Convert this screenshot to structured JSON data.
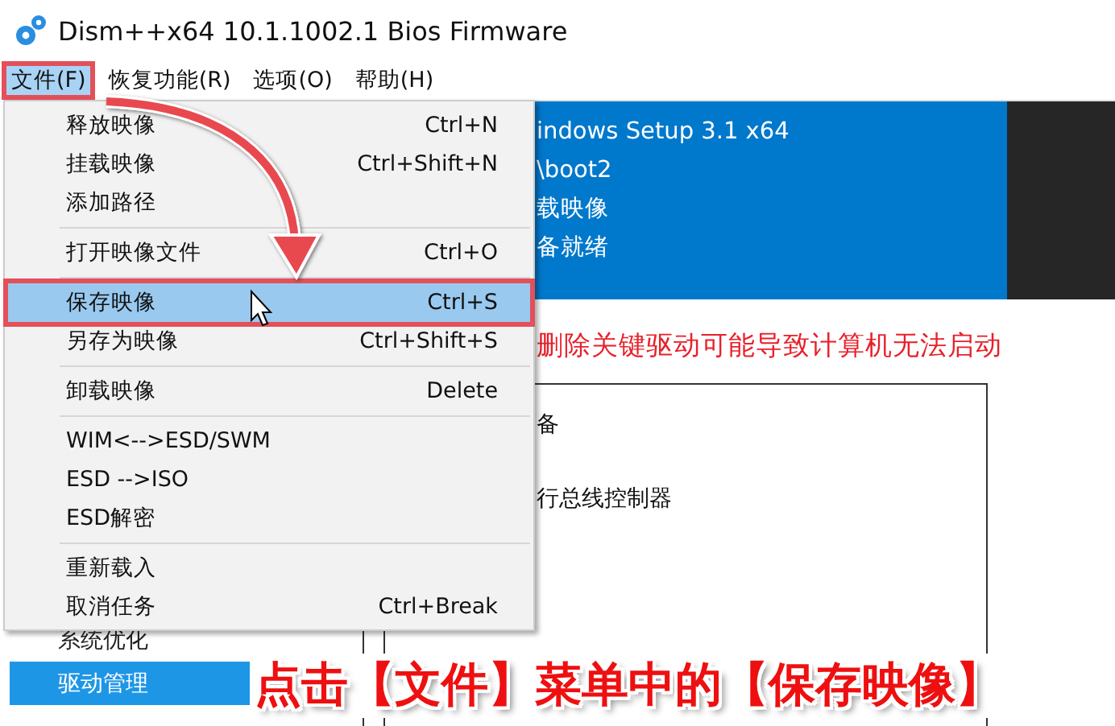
{
  "window": {
    "title": "Dism++x64 10.1.1002.1 Bios Firmware"
  },
  "menu_bar": [
    {
      "label": "文件(F)",
      "selected": true
    },
    {
      "label": "恢复功能(R)",
      "selected": false
    },
    {
      "label": "选项(O)",
      "selected": false
    },
    {
      "label": "帮助(H)",
      "selected": false
    }
  ],
  "file_menu": {
    "groups": [
      [
        {
          "label": "释放映像",
          "shortcut": "Ctrl+N",
          "selected": false
        },
        {
          "label": "挂载映像",
          "shortcut": "Ctrl+Shift+N",
          "selected": false
        },
        {
          "label": "添加路径",
          "selected": false
        }
      ],
      [
        {
          "label": "打开映像文件",
          "shortcut": "Ctrl+O",
          "selected": false
        }
      ],
      [
        {
          "label": "保存映像",
          "shortcut": "Ctrl+S",
          "selected": true
        },
        {
          "label": "另存为映像",
          "shortcut": "Ctrl+Shift+S",
          "selected": false
        }
      ],
      [
        {
          "label": "卸载映像",
          "shortcut": "Delete",
          "selected": false
        }
      ],
      [
        {
          "label": "WIM<-->ESD/SWM",
          "selected": false
        },
        {
          "label": "ESD -->ISO",
          "selected": false
        },
        {
          "label": "ESD解密",
          "selected": false
        }
      ],
      [
        {
          "label": "重新载入",
          "selected": false
        },
        {
          "label": "取消任务",
          "shortcut": "Ctrl+Break",
          "selected": false
        }
      ]
    ]
  },
  "header": {
    "lines": [
      "indows Setup 3.1 x64",
      "\\boot2",
      "载映像",
      "备就绪"
    ]
  },
  "warning": "删除关键驱动可能导致计算机无法启动",
  "device_tree": {
    "items": [
      "备",
      "行总线控制器"
    ]
  },
  "sidebar": {
    "items": [
      {
        "label": "系统优化",
        "selected": false
      },
      {
        "label": "驱动管理",
        "selected": true
      }
    ]
  },
  "annotation": {
    "caption": "点击【文件】菜单中的【保存映像】"
  }
}
